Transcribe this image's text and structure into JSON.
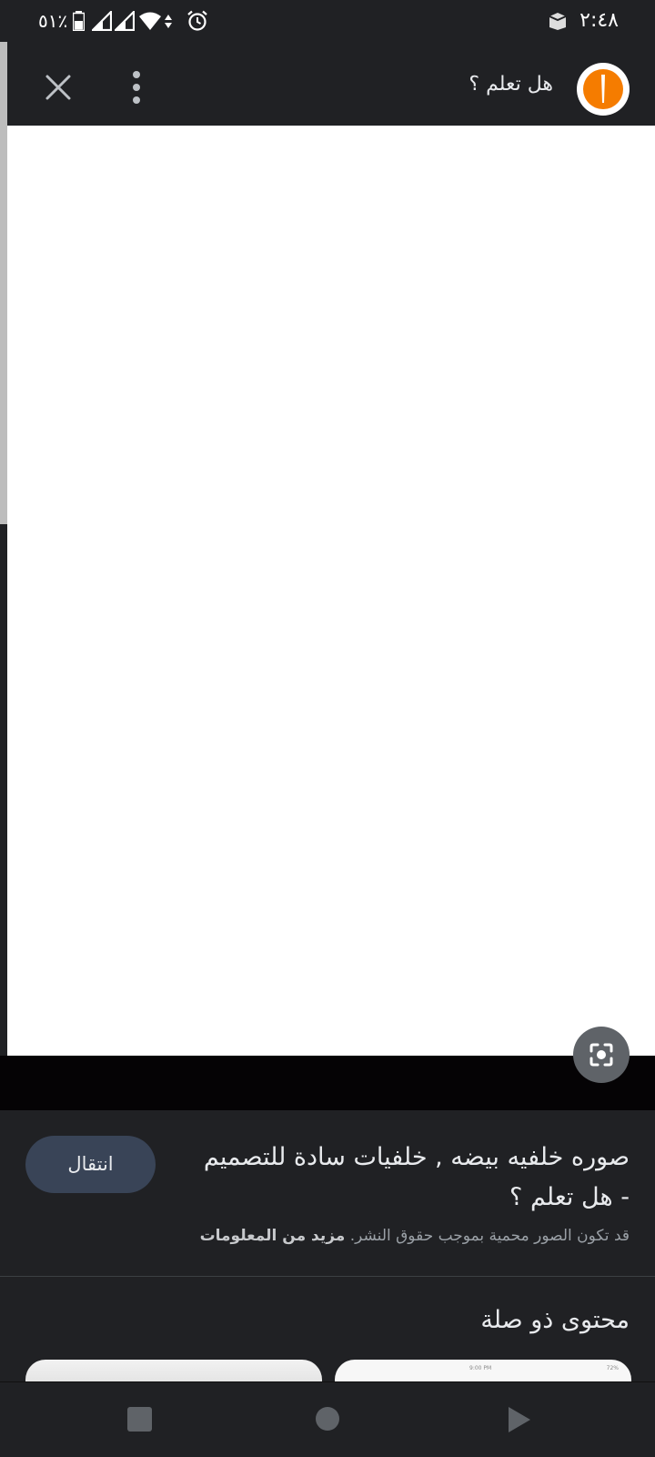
{
  "status_bar": {
    "time": "٢:٤٨",
    "battery": "٥١٪",
    "icons": [
      "box-icon",
      "battery-icon",
      "signal-icon",
      "signal-icon",
      "wifi-icon",
      "data-arrows-icon",
      "alarm-icon"
    ]
  },
  "app_bar": {
    "site_title": "هل تعلم ؟",
    "logo_icon": "site-logo-icon",
    "more_icon": "more-vert-icon",
    "close_icon": "close-icon"
  },
  "image": {
    "lens_icon": "google-lens-icon"
  },
  "result": {
    "title": "صوره خلفيه بيضه , خلفيات سادة للتصميم - هل تعلم ؟",
    "visit_button": "انتقال",
    "copyright_note": "قد تكون الصور محمية بموجب حقوق النشر.",
    "learn_more": "مزيد من المعلومات"
  },
  "related": {
    "heading": "محتوى ذو صلة",
    "thumb2_time": "9:00 PM",
    "thumb2_battery": "72%"
  },
  "colors": {
    "background": "#202124",
    "accent_orange": "#f57c00",
    "button": "#394457"
  },
  "nav_bar": {
    "icons": [
      "recents-square-icon",
      "home-circle-icon",
      "back-triangle-icon"
    ]
  }
}
